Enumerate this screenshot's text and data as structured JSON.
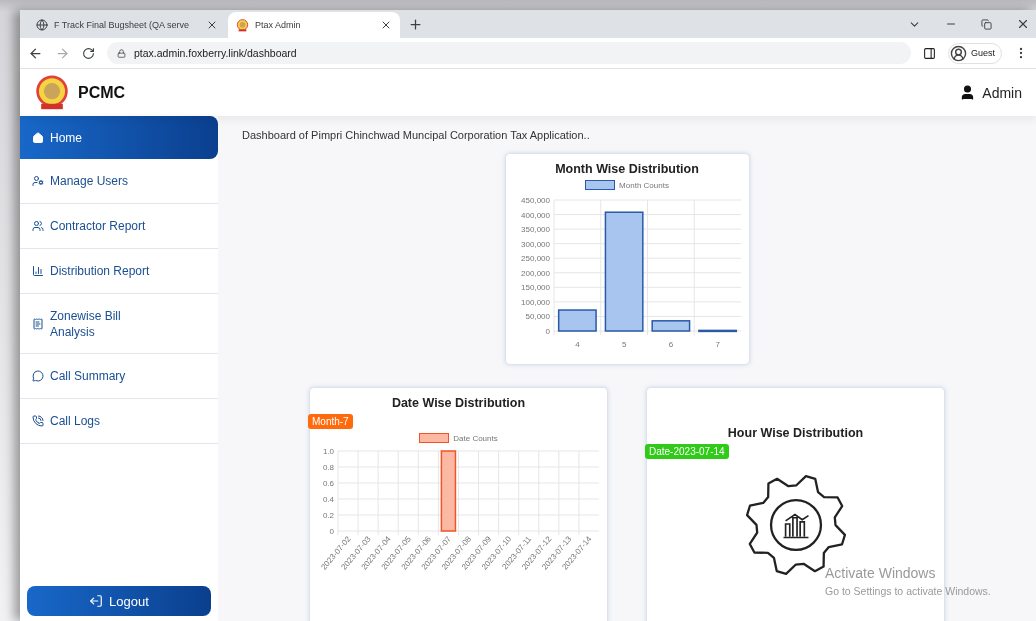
{
  "browser": {
    "tabs": [
      {
        "title": "F Track Final Bugsheet (QA serve",
        "kind": "globe",
        "selected": false
      },
      {
        "title": "Ptax Admin",
        "kind": "emblem",
        "selected": true
      }
    ],
    "url": "ptax.admin.foxberry.link/dashboard",
    "profile": "Guest"
  },
  "header": {
    "brand": "PCMC",
    "user": "Admin"
  },
  "sidebar": {
    "items": [
      {
        "label": "Home",
        "kind": "home",
        "selected": true
      },
      {
        "label": "Manage Users",
        "kind": "user",
        "selected": false
      },
      {
        "label": "Contractor Report",
        "kind": "users",
        "selected": false
      },
      {
        "label": "Distribution Report",
        "kind": "bars",
        "selected": false
      },
      {
        "label": "Zonewise Bill Analysis",
        "kind": "sheet",
        "selected": false
      },
      {
        "label": "Call Summary",
        "kind": "message",
        "selected": false
      },
      {
        "label": "Call Logs",
        "kind": "phone",
        "selected": false
      }
    ],
    "logout": "Logout"
  },
  "main": {
    "subtitle": "Dashboard of Pimpri Chinchwad Muncipal Corporation Tax Application..",
    "cards": [
      {
        "kind": "chart",
        "chart_data": {
          "type": "bar",
          "title": "Month Wise Distribution",
          "categories": [
            "4",
            "5",
            "6",
            "7"
          ],
          "series": [
            {
              "name": "Month Counts",
              "color": "#a7c5ef",
              "values": [
                72000,
                408000,
                35000,
                2000
              ]
            }
          ],
          "grid": true,
          "ylim": [
            0,
            450000
          ],
          "yticks": [
            {
              "value": 0,
              "label": "0"
            },
            {
              "value": 50000,
              "label": "50,000"
            },
            {
              "value": 100000,
              "label": "100,000"
            },
            {
              "value": 150000,
              "label": "150,000"
            },
            {
              "value": 200000,
              "label": "200,000"
            },
            {
              "value": 250000,
              "label": "250,000"
            },
            {
              "value": 300000,
              "label": "300,000"
            },
            {
              "value": 350000,
              "label": "350,000"
            },
            {
              "value": 400000,
              "label": "400,000"
            },
            {
              "value": 450000,
              "label": "450,000"
            }
          ]
        }
      },
      {
        "kind": "chart",
        "badge": {
          "text": "Month-7",
          "color": "#ff6a0d"
        },
        "chart_data": {
          "type": "bar",
          "title": "Date Wise Distribution",
          "categories": [
            "2023-07-02",
            "2023-07-03",
            "2023-07-04",
            "2023-07-05",
            "2023-07-06",
            "2023-07-07",
            "2023-07-08",
            "2023-07-09",
            "2023-07-10",
            "2023-07-11",
            "2023-07-12",
            "2023-07-13",
            "2023-07-14"
          ],
          "series": [
            {
              "name": "Date Counts",
              "color": "#fbb9a3",
              "values": [
                0,
                0,
                0,
                0,
                0,
                1,
                0,
                0,
                0,
                0,
                0,
                0,
                0
              ]
            }
          ],
          "grid": true,
          "ylim": [
            0,
            1
          ],
          "yticks": [
            {
              "value": 0,
              "label": "0"
            },
            {
              "value": 0.2,
              "label": "0.2"
            },
            {
              "value": 0.4,
              "label": "0.4"
            },
            {
              "value": 0.6,
              "label": "0.6"
            },
            {
              "value": 0.8,
              "label": "0.8"
            },
            {
              "value": 1,
              "label": "1.0"
            }
          ]
        }
      },
      {
        "kind": "empty",
        "title": "Hour Wise Distribution",
        "badge": {
          "text": "Date-2023-07-14",
          "color": "#2fcb18"
        }
      }
    ]
  },
  "overlay": {
    "title": "Activate Windows",
    "hint": "Go to Settings to activate Windows."
  }
}
